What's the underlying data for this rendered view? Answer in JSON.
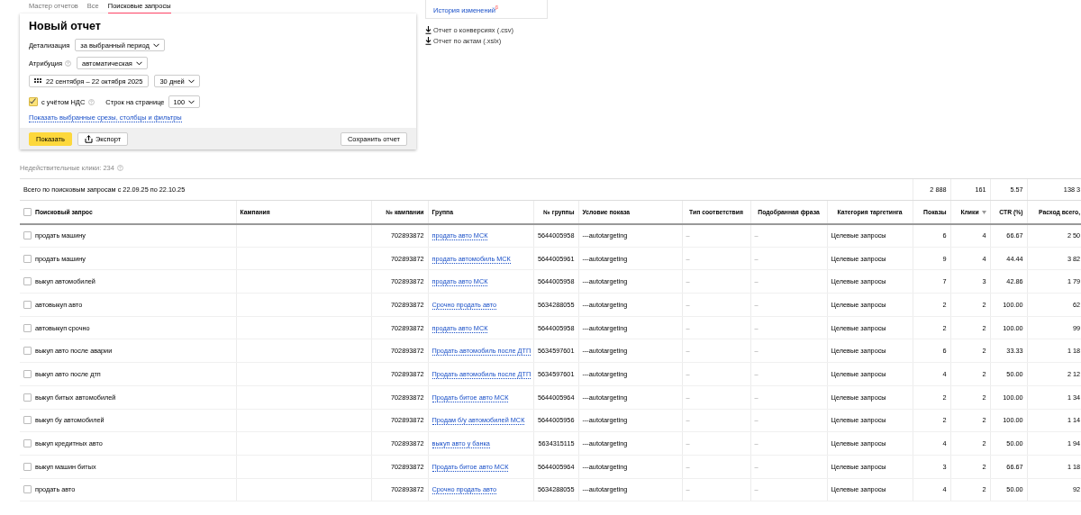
{
  "tabs": [
    {
      "label": "Мастер отчетов",
      "selected": false
    },
    {
      "label": "Все",
      "selected": false
    },
    {
      "label": "Поисковые запросы",
      "selected": true
    }
  ],
  "report": {
    "title": "Новый отчет",
    "detail": {
      "label": "Детализация",
      "value": "за выбранный период"
    },
    "attribution": {
      "label": "Атрибуция",
      "value": "автоматическая"
    },
    "date_range": "22 сентября – 22 октября 2025",
    "period": "30 дней",
    "vat": {
      "label": "с учётом НДС",
      "checked": true
    },
    "rows_per_page": {
      "label": "Строк на странице",
      "value": "100"
    },
    "show_link": "Показать выбранные срезы, столбцы и фильтры",
    "buttons": [
      {
        "label": "Показать",
        "kind": "primary"
      },
      {
        "label": "Экспорт",
        "kind": "export"
      },
      {
        "label": "Сохранить отчет",
        "kind": "plain"
      }
    ]
  },
  "side": {
    "history_link": "История изменений$^{β}$",
    "downloads": [
      "Отчет о конверсиях (.csv)",
      "Отчет по актам (.xslx)"
    ]
  },
  "invalid_clicks": "Недействительные клики: 234",
  "table": {
    "total_label": "Всего по поисковым запросам с 22.09.25 по 22.10.25",
    "totals": [
      "2 888",
      "161",
      "5.57",
      "138 3"
    ],
    "columns": [
      {
        "label": "Поисковый запрос",
        "sorted": false
      },
      {
        "label": "Кампания",
        "sorted": false
      },
      {
        "label": "№ кампании",
        "sorted": false
      },
      {
        "label": "Группа",
        "sorted": false
      },
      {
        "label": "№ группы",
        "sorted": false
      },
      {
        "label": "Условие показа",
        "sorted": false
      },
      {
        "label": "Тип соответствия",
        "sorted": false
      },
      {
        "label": "Подобранная фраза",
        "sorted": false
      },
      {
        "label": "Категория таргетинга",
        "sorted": false
      },
      {
        "label": "Показы",
        "sorted": false
      },
      {
        "label": "Клики",
        "sorted": true
      },
      {
        "label": "CTR (%)",
        "sorted": false
      },
      {
        "label": "Расход всего,",
        "sorted": false
      }
    ],
    "header_checked": false,
    "rows": [
      {
        "checked": false,
        "query": "продать машину",
        "campaign_no": "702893872",
        "group": "продать авто МСК",
        "group_no": "5644005958",
        "condition": "---autotargeting",
        "match": "–",
        "phrase": "–",
        "category": "Целевые запросы",
        "impressions": "6",
        "clicks": "4",
        "ctr": "66.67",
        "cost": "2 50"
      },
      {
        "checked": false,
        "query": "продать машину",
        "campaign_no": "702893872",
        "group": "продать автомобиль МСК",
        "group_no": "5644005961",
        "condition": "---autotargeting",
        "match": "–",
        "phrase": "–",
        "category": "Целевые запросы",
        "impressions": "9",
        "clicks": "4",
        "ctr": "44.44",
        "cost": "3 82"
      },
      {
        "checked": false,
        "query": "выкуп автомобилей",
        "campaign_no": "702893872",
        "group": "продать авто МСК",
        "group_no": "5644005958",
        "condition": "---autotargeting",
        "match": "–",
        "phrase": "–",
        "category": "Целевые запросы",
        "impressions": "7",
        "clicks": "3",
        "ctr": "42.86",
        "cost": "1 79"
      },
      {
        "checked": false,
        "query": "автовыкуп авто",
        "campaign_no": "702893872",
        "group": "Срочно продать авто",
        "group_no": "5634288055",
        "condition": "---autotargeting",
        "match": "–",
        "phrase": "–",
        "category": "Целевые запросы",
        "impressions": "2",
        "clicks": "2",
        "ctr": "100.00",
        "cost": "62"
      },
      {
        "checked": false,
        "query": "автовыкуп срочно",
        "campaign_no": "702893872",
        "group": "продать авто МСК",
        "group_no": "5644005958",
        "condition": "---autotargeting",
        "match": "–",
        "phrase": "–",
        "category": "Целевые запросы",
        "impressions": "2",
        "clicks": "2",
        "ctr": "100.00",
        "cost": "99"
      },
      {
        "checked": false,
        "query": "выкуп авто после аварии",
        "campaign_no": "702893872",
        "group": "Продать автомобиль после ДТП",
        "group_no": "5634597601",
        "condition": "---autotargeting",
        "match": "–",
        "phrase": "–",
        "category": "Целевые запросы",
        "impressions": "6",
        "clicks": "2",
        "ctr": "33.33",
        "cost": "1 18"
      },
      {
        "checked": false,
        "query": "выкуп авто после дтп",
        "campaign_no": "702893872",
        "group": "Продать автомобиль после ДТП",
        "group_no": "5634597601",
        "condition": "---autotargeting",
        "match": "–",
        "phrase": "–",
        "category": "Целевые запросы",
        "impressions": "4",
        "clicks": "2",
        "ctr": "50.00",
        "cost": "2 12"
      },
      {
        "checked": false,
        "query": "выкуп битых автомобилей",
        "campaign_no": "702893872",
        "group": "Продать битое авто МСК",
        "group_no": "5644005964",
        "condition": "---autotargeting",
        "match": "–",
        "phrase": "–",
        "category": "Целевые запросы",
        "impressions": "2",
        "clicks": "2",
        "ctr": "100.00",
        "cost": "1 34"
      },
      {
        "checked": false,
        "query": "выкуп бу автомобилей",
        "campaign_no": "702893872",
        "group": "Продам б/у автомобилей МСК",
        "group_no": "5644005956",
        "condition": "---autotargeting",
        "match": "–",
        "phrase": "–",
        "category": "Целевые запросы",
        "impressions": "2",
        "clicks": "2",
        "ctr": "100.00",
        "cost": "1 14"
      },
      {
        "checked": false,
        "query": "выкуп кредитных авто",
        "campaign_no": "702893872",
        "group": "выкуп авто у банка",
        "group_no": "5634315115",
        "condition": "---autotargeting",
        "match": "–",
        "phrase": "–",
        "category": "Целевые запросы",
        "impressions": "4",
        "clicks": "2",
        "ctr": "50.00",
        "cost": "1 94"
      },
      {
        "checked": false,
        "query": "выкуп машин битых",
        "campaign_no": "702893872",
        "group": "Продать битое авто МСК",
        "group_no": "5644005964",
        "condition": "---autotargeting",
        "match": "–",
        "phrase": "–",
        "category": "Целевые запросы",
        "impressions": "3",
        "clicks": "2",
        "ctr": "66.67",
        "cost": "1 18"
      },
      {
        "checked": false,
        "query": "продать авто",
        "campaign_no": "702893872",
        "group": "Срочно продать авто",
        "group_no": "5634288055",
        "condition": "---autotargeting",
        "match": "–",
        "phrase": "–",
        "category": "Целевые запросы",
        "impressions": "4",
        "clicks": "2",
        "ctr": "50.00",
        "cost": "92"
      }
    ]
  }
}
